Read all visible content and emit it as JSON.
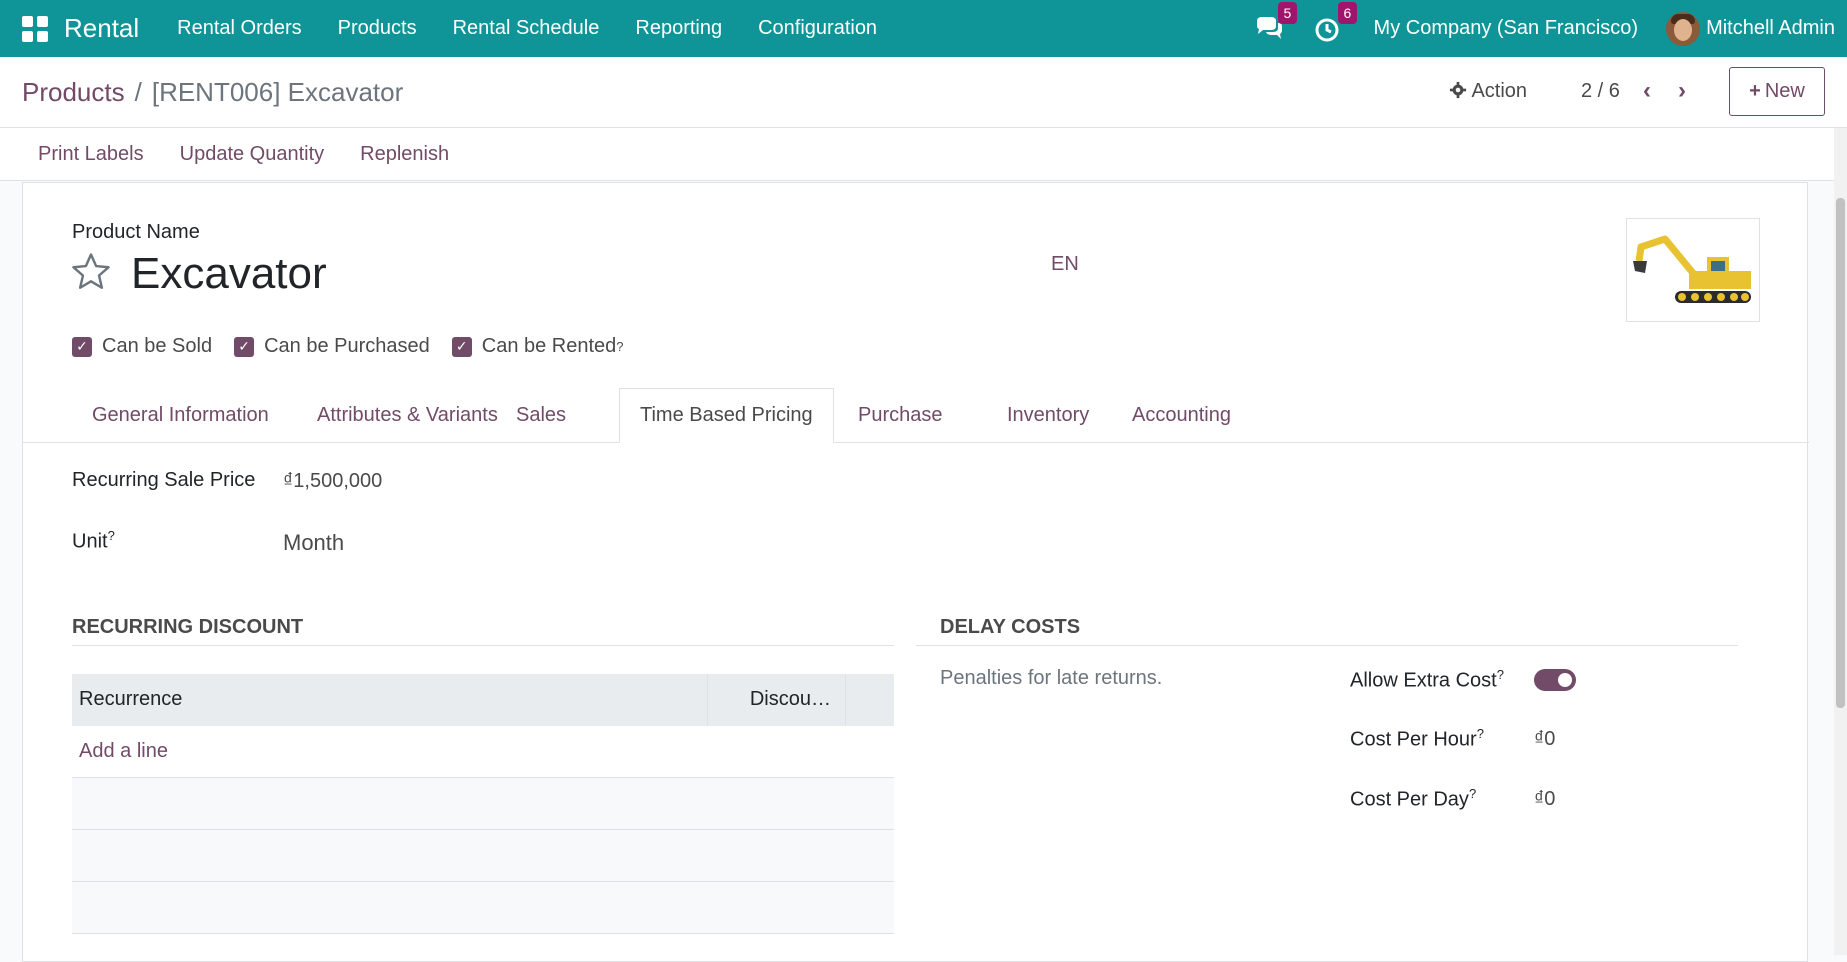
{
  "topbar": {
    "brand": "Rental",
    "menu": [
      "Rental Orders",
      "Products",
      "Rental Schedule",
      "Reporting",
      "Configuration"
    ],
    "messages_badge": "5",
    "activities_badge": "6",
    "company": "My Company (San Francisco)",
    "user": "Mitchell Admin"
  },
  "control": {
    "breadcrumb_root": "Products",
    "breadcrumb_sep": "/",
    "breadcrumb_current": "[RENT006] Excavator",
    "action_label": "Action",
    "pager": "2 / 6",
    "new_label": "New"
  },
  "statusbar": {
    "buttons": [
      "Print Labels",
      "Update Quantity",
      "Replenish"
    ]
  },
  "product": {
    "name_label": "Product Name",
    "name": "Excavator",
    "lang": "EN",
    "checks": [
      {
        "label": "Can be Sold",
        "checked": true
      },
      {
        "label": "Can be Purchased",
        "checked": true
      },
      {
        "label": "Can be Rented",
        "checked": true,
        "help": "?"
      }
    ]
  },
  "tabs": [
    "General Information",
    "Attributes & Variants",
    "Sales",
    "Time Based Pricing",
    "Purchase",
    "Inventory",
    "Accounting"
  ],
  "active_tab": "Time Based Pricing",
  "pricing": {
    "recurring_price_label": "Recurring Sale Price",
    "recurring_price_value": "₫1,500,000",
    "unit_label": "Unit",
    "unit_help": "?",
    "unit_value": "Month"
  },
  "discount": {
    "title": "RECURRING DISCOUNT",
    "col_recurrence": "Recurrence",
    "col_discount": "Discou…",
    "add_line": "Add a line"
  },
  "delay": {
    "title": "DELAY COSTS",
    "description": "Penalties for late returns.",
    "allow_extra_label": "Allow Extra Cost",
    "allow_extra_enabled": true,
    "cost_hour_label": "Cost Per Hour",
    "cost_hour_value": "₫0",
    "cost_day_label": "Cost Per Day",
    "cost_day_value": "₫0",
    "help": "?"
  },
  "colors": {
    "topbar": "#0f9498",
    "accent": "#714b67",
    "badge": "#a0156c"
  }
}
